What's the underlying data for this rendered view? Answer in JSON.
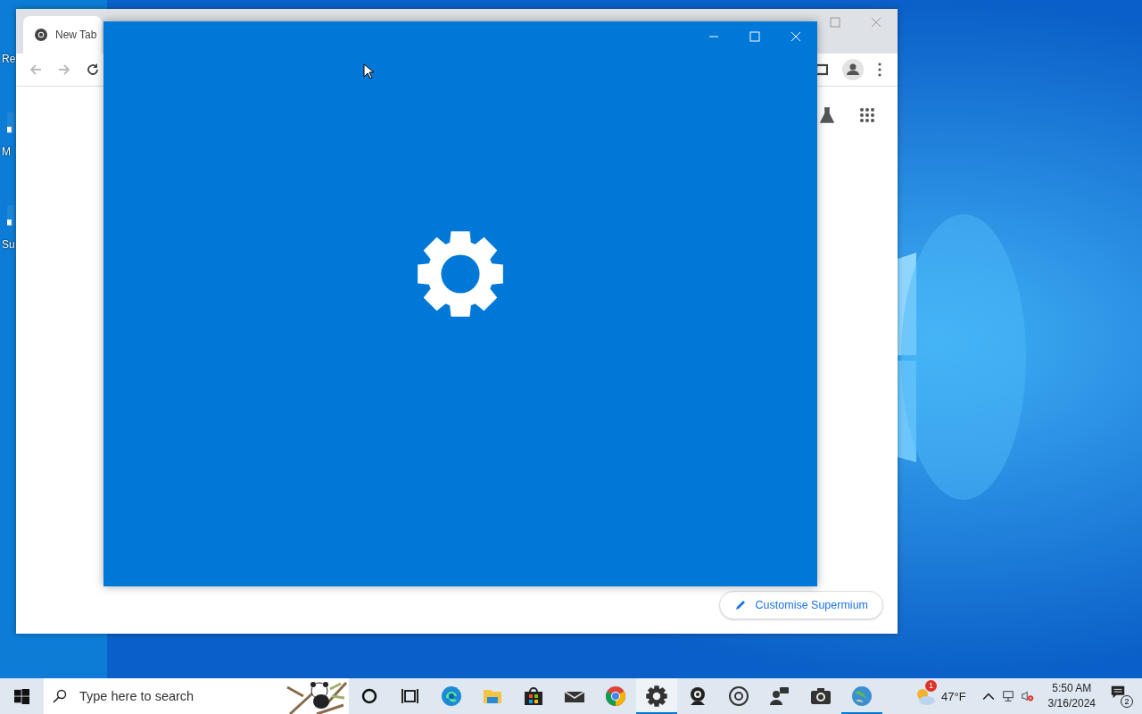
{
  "desktop_icons": [
    {
      "label": "Re"
    },
    {
      "label": "M"
    },
    {
      "label": "Su"
    }
  ],
  "browser": {
    "tab": {
      "title": "New Tab"
    },
    "customise_button": "Customise Supermium"
  },
  "taskbar": {
    "search": {
      "placeholder": "Type here to search"
    },
    "apps": [
      {
        "kind": "cortana",
        "selected": false,
        "running": false
      },
      {
        "kind": "taskview",
        "selected": false,
        "running": false
      },
      {
        "kind": "edge",
        "selected": false,
        "running": false
      },
      {
        "kind": "folder",
        "selected": false,
        "running": false
      },
      {
        "kind": "store",
        "selected": false,
        "running": false
      },
      {
        "kind": "mail",
        "selected": false,
        "running": false
      },
      {
        "kind": "chrome",
        "selected": false,
        "running": false
      },
      {
        "kind": "gear",
        "selected": true,
        "running": true
      },
      {
        "kind": "webcam",
        "selected": false,
        "running": false
      },
      {
        "kind": "disc",
        "selected": false,
        "running": false
      },
      {
        "kind": "people",
        "selected": false,
        "running": false
      },
      {
        "kind": "camera",
        "selected": false,
        "running": false
      },
      {
        "kind": "globe",
        "selected": false,
        "running": true
      }
    ],
    "weather": {
      "temperature": "47°F",
      "badge": "1"
    },
    "time": "5:50 AM",
    "date": "3/16/2024",
    "notifications": "2"
  }
}
